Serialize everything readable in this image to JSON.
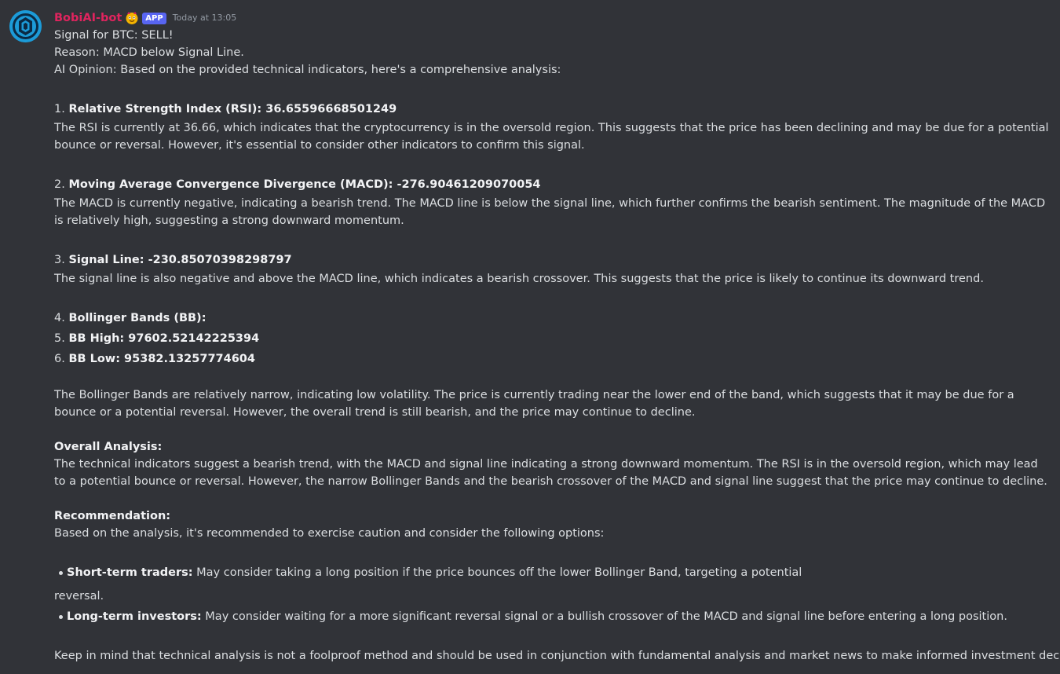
{
  "message": {
    "author": "BobiAI-bot",
    "badge": "APP",
    "timestamp": "Today at 13:05",
    "colors": {
      "author": "#e0245e",
      "badge": "#5865f2",
      "background": "#313338"
    },
    "avatar_icon": "bot-avatar-icon",
    "role_icon": "face-emoji-icon",
    "signal_line": "Signal for BTC: SELL!",
    "reason_line": "Reason: MACD below Signal Line.",
    "opinion_line": "AI Opinion: Based on the provided technical indicators, here's a comprehensive analysis:",
    "rsi": {
      "num": "1. ",
      "title": "Relative Strength Index (RSI): 36.65596668501249",
      "body": "The RSI is currently at 36.66, which indicates that the cryptocurrency is in the oversold region. This suggests that the price has been declining and may be due for a potential bounce or reversal. However, it's essential to consider other indicators to confirm this signal."
    },
    "macd": {
      "num": "2. ",
      "title": "Moving Average Convergence Divergence (MACD): -276.90461209070054",
      "body": "The MACD is currently negative, indicating a bearish trend. The MACD line is below the signal line, which further confirms the bearish sentiment. The magnitude of the MACD is relatively high, suggesting a strong downward momentum."
    },
    "signal": {
      "num": "3. ",
      "title": "Signal Line: -230.85070398298797",
      "body": "The signal line is also negative and above the MACD line, which indicates a bearish crossover. This suggests that the price is likely to continue its downward trend."
    },
    "bb": {
      "num": "4. ",
      "title": "Bollinger Bands (BB):",
      "high_num": "5. ",
      "high": "BB High: 97602.52142225394",
      "low_num": "6. ",
      "low": "BB Low: 95382.13257774604",
      "body": "The Bollinger Bands are relatively narrow, indicating low volatility. The price is currently trading near the lower end of the band, which suggests that it may be due for a bounce or a potential reversal. However, the overall trend is still bearish, and the price may continue to decline."
    },
    "overall": {
      "title": "Overall Analysis:",
      "body": "The technical indicators suggest a bearish trend, with the MACD and signal line indicating a strong downward momentum. The RSI is in the oversold region, which may lead to a potential bounce or reversal. However, the narrow Bollinger Bands and the bearish crossover of the MACD and signal line suggest that the price may continue to decline."
    },
    "recommendation": {
      "title": "Recommendation:",
      "intro": "Based on the analysis, it's recommended to exercise caution and consider the following options:",
      "short_label": "Short-term traders:",
      "short_text": " May consider taking a long position if the price bounces off the lower Bollinger Band, targeting a potential",
      "short_cont": "reversal.",
      "long_label": "Long-term investors:",
      "long_text": " May consider waiting for a more significant reversal signal or a bullish crossover of the MACD and signal line before entering a long position."
    },
    "closing": "Keep in mind that technical analysis is not a foolproof method and should be used in conjunction with fundamental analysis and market news to make informed investment decisions."
  }
}
